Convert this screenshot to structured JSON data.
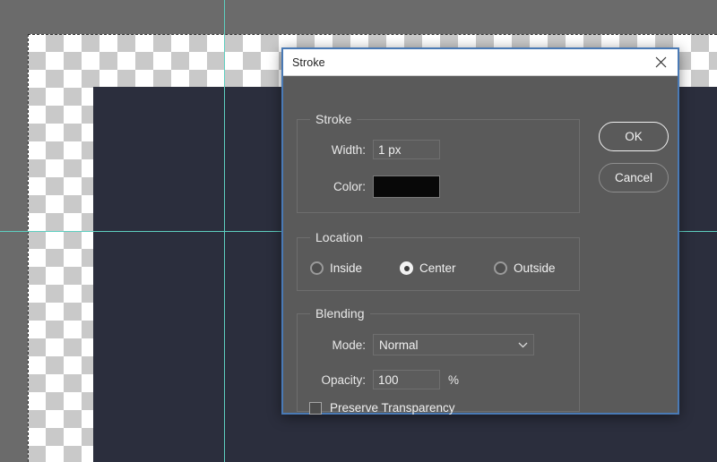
{
  "canvas": {
    "background_color": "#6b6b6b",
    "artwork_color": "#2b2e3d",
    "guide_color": "#5ecfc0",
    "checker_light": "#ffffff",
    "checker_dark": "#c9c9c9"
  },
  "dialog": {
    "title": "Stroke",
    "close_icon": "close-icon",
    "accent_border": "#4a7ab5",
    "groups": {
      "stroke": {
        "legend": "Stroke",
        "width_label": "Width:",
        "width_value": "1 px",
        "width_placeholder": "1 px",
        "color_label": "Color:",
        "color_value": "#080808"
      },
      "location": {
        "legend": "Location",
        "options": [
          {
            "label": "Inside",
            "selected": false
          },
          {
            "label": "Center",
            "selected": true
          },
          {
            "label": "Outside",
            "selected": false
          }
        ]
      },
      "blending": {
        "legend": "Blending",
        "mode_label": "Mode:",
        "mode_value": "Normal",
        "mode_chevron": "chevron-down-icon",
        "opacity_label": "Opacity:",
        "opacity_value": "100",
        "opacity_placeholder": "100",
        "percent_symbol": "%",
        "preserve_label": "Preserve Transparency",
        "preserve_checked": false
      }
    },
    "buttons": {
      "ok": "OK",
      "cancel": "Cancel"
    }
  }
}
